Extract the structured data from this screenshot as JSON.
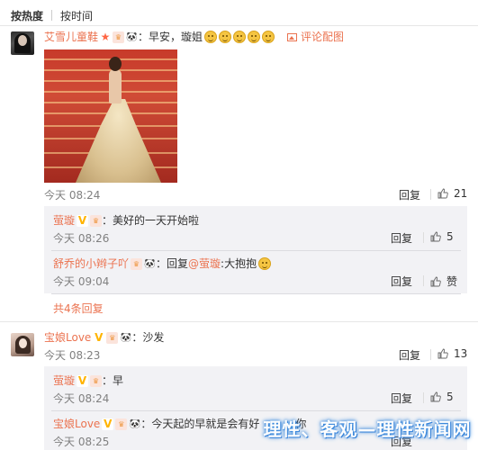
{
  "sort": {
    "hot": "按热度",
    "time": "按时间"
  },
  "comments": [
    {
      "user": "艾雪儿童鞋",
      "text": "：早安，璇姐",
      "view_pic": "评论配图",
      "time": "今天 08:24",
      "reply": "回复",
      "likes": "21",
      "replies": [
        {
          "user": "萤璇",
          "text": "：美好的一天开始啦",
          "time": "今天 08:26",
          "reply": "回复",
          "likes": "5"
        },
        {
          "user": "舒乔的小辫子吖",
          "text_prefix": "：回复",
          "mention": "@萤璇",
          "text_suffix": ":大抱抱",
          "time": "今天 09:04",
          "reply": "回复",
          "likes": "赞"
        }
      ],
      "more": "共4条回复"
    },
    {
      "user": "宝娘Love",
      "text": "：沙发",
      "time": "今天 08:23",
      "reply": "回复",
      "likes": "13",
      "replies": [
        {
          "user": "萤璇",
          "text": "：早",
          "time": "今天 08:24",
          "reply": "回复",
          "likes": "5"
        },
        {
          "user": "宝娘Love",
          "text": "：今天起的早就是会有好",
          "trail": "你",
          "time": "今天 08:25",
          "reply": "回复"
        }
      ]
    }
  ],
  "watermark": "理性、客观—理性新闻网",
  "colors": {
    "link": "#eb7350",
    "reply_bg": "#f2f2f5",
    "muted": "#808080"
  },
  "icons": [
    "star-badge-icon",
    "vip-icon",
    "panda-icon",
    "smile-emoji-icon",
    "picture-icon",
    "thumbs-up-icon",
    "v-verified-icon",
    "hug-emoji-icon"
  ]
}
